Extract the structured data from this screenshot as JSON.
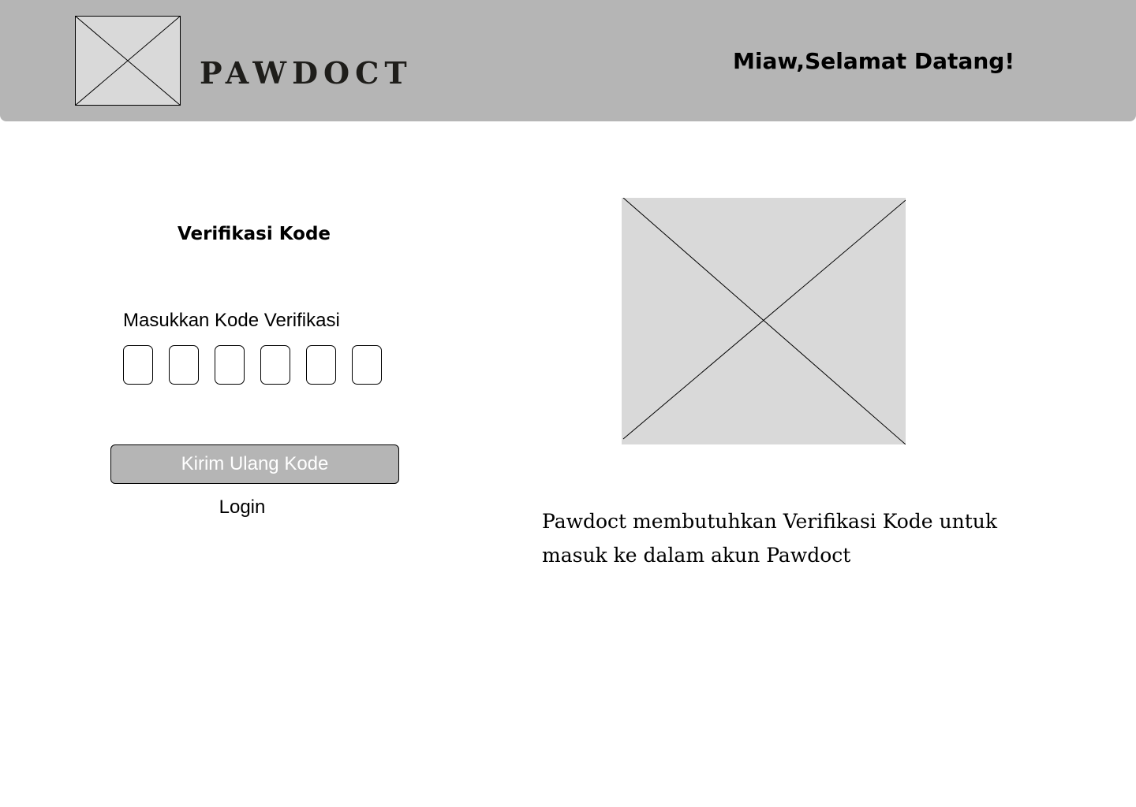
{
  "header": {
    "logo_icon": "image-placeholder-icon",
    "brand": "PAWDOCT",
    "greeting": "Miaw,Selamat Datang!"
  },
  "form": {
    "title": "Verifikasi Kode",
    "code_label": "Masukkan Kode Verifikasi",
    "code_digits": [
      "",
      "",
      "",
      "",
      "",
      ""
    ],
    "resend_label": "Kirim Ulang Kode",
    "login_label": "Login"
  },
  "info": {
    "image_icon": "image-placeholder-icon",
    "description": "Pawdoct membutuhkan Verifikasi Kode untuk masuk ke dalam akun Pawdoct"
  },
  "colors": {
    "header_bg": "#b5b5b5",
    "placeholder_bg": "#d9d9d9",
    "button_bg": "#b5b5b5",
    "button_text": "#ffffff",
    "text": "#000000"
  }
}
